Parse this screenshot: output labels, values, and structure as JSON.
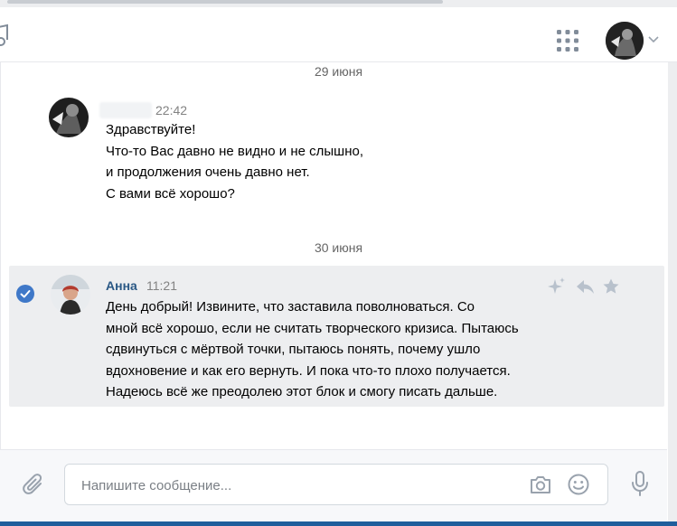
{
  "header": {
    "music_icon": "music-note-icon",
    "apps_icon": "apps-grid-icon",
    "profile_icon": "user-avatar",
    "menu_icon": "chevron-down-icon"
  },
  "conversation": {
    "date1": "29 июня",
    "message1": {
      "time": "22:42",
      "lines": "Здравствуйте!\nЧто-то Вас давно не видно и не слышно,\nи продолжения очень давно нет.\nС вами всё хорошо?"
    },
    "date2": "30 июня",
    "message2": {
      "author": "Анна",
      "time": "11:21",
      "text": "День добрый! Извините, что заставила поволноваться. Со\nмной всё хорошо, если не считать творческого кризиса. Пытаюсь\nсдвинуться с мёртвой точки, пытаюсь понять, почему ушло\nвдохновение и как его вернуть. И пока что-то плохо получается.\nНадеюсь всё же преодолею этот блок и смогу писать дальше.",
      "selected": true,
      "action_icons": [
        "sparkle-icon",
        "reply-icon",
        "star-icon"
      ]
    }
  },
  "composer": {
    "placeholder": "Напишите сообщение...",
    "value": "",
    "attach_icon": "paperclip-icon",
    "camera_icon": "camera-icon",
    "emoji_icon": "smile-icon",
    "voice_icon": "microphone-icon"
  },
  "colors": {
    "link": "#2a5885",
    "selected_bg": "#edeef0",
    "check": "#3f78c8",
    "icon_gray": "#99a2ad",
    "action_icon": "#b8c1cc"
  }
}
